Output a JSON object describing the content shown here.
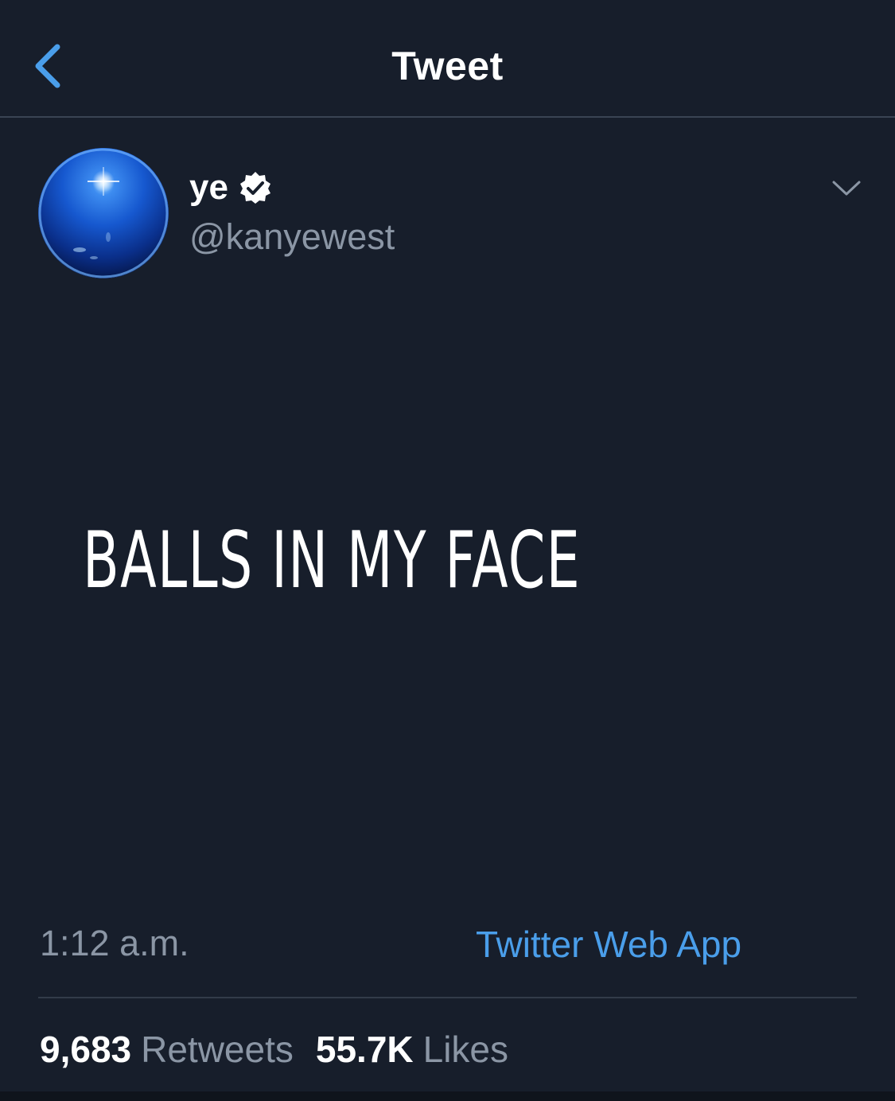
{
  "header": {
    "title": "Tweet",
    "back_icon": "chevron-left-icon"
  },
  "author": {
    "display_name": "ye",
    "username": "@kanyewest",
    "verified_icon": "verified-badge-icon",
    "avatar_icon": "blue-sphere-avatar"
  },
  "tweet": {
    "text": "BALLS IN MY FACE",
    "time": "1:12 a.m.",
    "source": "Twitter Web App"
  },
  "stats": {
    "retweets_count": "9,683",
    "retweets_label": "Retweets",
    "likes_count": "55.7K",
    "likes_label": "Likes"
  },
  "colors": {
    "background": "#171e2b",
    "accent": "#4a9eea",
    "secondary_text": "#8b96a5",
    "divider": "#323b49"
  }
}
